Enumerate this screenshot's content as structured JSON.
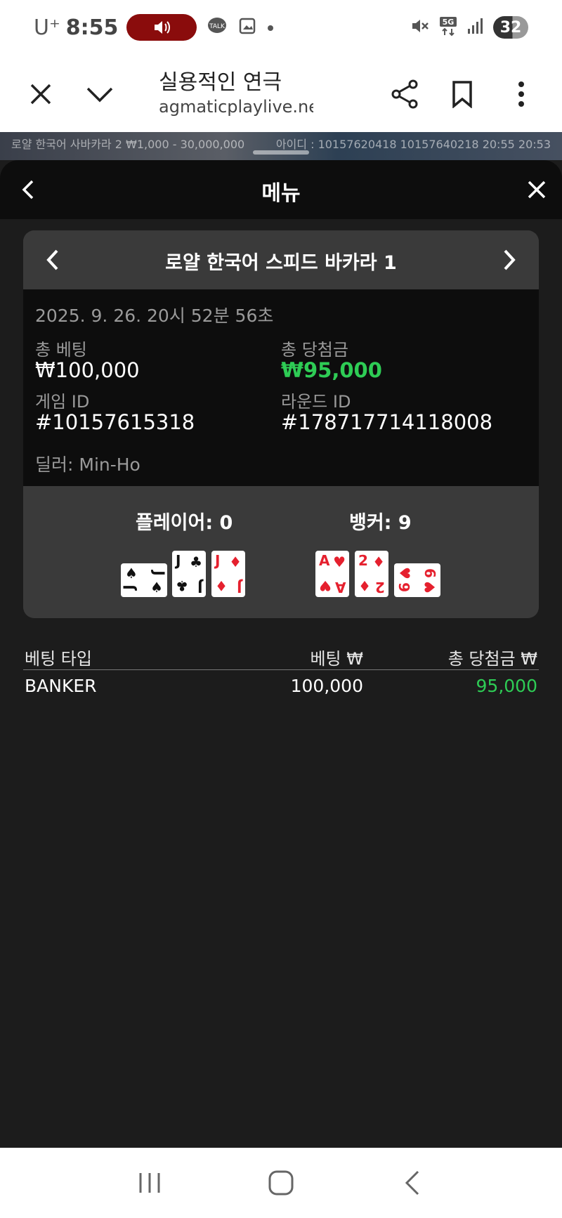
{
  "status_bar": {
    "carrier": "U⁺",
    "time": "8:55",
    "network": "5G",
    "battery": "32"
  },
  "browser": {
    "title": "실용적인 연극",
    "url": "agmaticplaylive.net"
  },
  "game_strip": {
    "left_text": "로얄 한국어 사바카라 2  ₩1,000 - 30,000,000",
    "right_text": "아이디 : 10157620418  10157640218  20:55  20:53"
  },
  "menu": {
    "title": "메뉴"
  },
  "card": {
    "table_name": "로얄 한국어 스피드 바카라 1",
    "date": "2025. 9. 26. 20시 52분 56초",
    "total_bet_label": "총 베팅",
    "total_bet_value": "₩100,000",
    "total_win_label": "총 당첨금",
    "total_win_value": "₩95,000",
    "game_id_label": "게임 ID",
    "game_id_value": "#10157615318",
    "round_id_label": "라운드 ID",
    "round_id_value": "#178717714118008",
    "dealer": "딜러: Min-Ho",
    "player_label": "플레이어: 0",
    "banker_label": "뱅커: 9",
    "player_cards": [
      {
        "rank": "J",
        "suit": "♠",
        "color": "black",
        "rotated": true
      },
      {
        "rank": "J",
        "suit": "♣",
        "color": "black",
        "rotated": false
      },
      {
        "rank": "J",
        "suit": "♦",
        "color": "red",
        "rotated": false
      }
    ],
    "banker_cards": [
      {
        "rank": "A",
        "suit": "♥",
        "color": "red",
        "rotated": false
      },
      {
        "rank": "2",
        "suit": "♦",
        "color": "red",
        "rotated": false
      },
      {
        "rank": "6",
        "suit": "♥",
        "color": "red",
        "rotated": true
      }
    ]
  },
  "bets": {
    "headers": [
      "베팅 타입",
      "베팅 ₩",
      "총 당첨금 ₩"
    ],
    "rows": [
      {
        "type": "BANKER",
        "bet": "100,000",
        "win": "95,000"
      }
    ]
  },
  "colors": {
    "win_green": "#2ecc55",
    "card_red": "#e5202e"
  }
}
